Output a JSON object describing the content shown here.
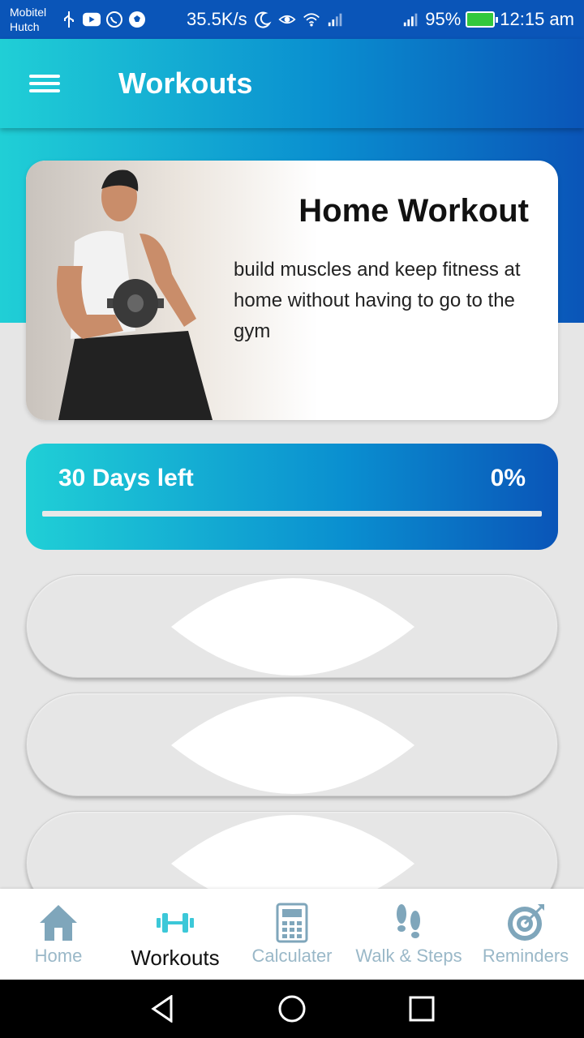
{
  "status_bar": {
    "carrier_line1": "Mobitel",
    "carrier_line2": "Hutch",
    "net_speed": "35.5K/s",
    "battery": "95%",
    "time": "12:15 am"
  },
  "app_bar": {
    "title": "Workouts",
    "menu_icon": "hamburger-menu-icon"
  },
  "promo": {
    "title": "Home Workout",
    "description": "build muscles and keep fitness at home without having to go to the gym"
  },
  "progress": {
    "days_left": "30 Days left",
    "percent": "0%",
    "fraction": 0
  },
  "workouts": [
    {
      "id": "workout-1"
    },
    {
      "id": "workout-2"
    },
    {
      "id": "workout-3"
    }
  ],
  "bottom_nav": {
    "items": [
      {
        "label": "Home",
        "icon": "home-icon",
        "active": false
      },
      {
        "label": "Workouts",
        "icon": "dumbbell-icon",
        "active": true
      },
      {
        "label": "Calculater",
        "icon": "calculator-icon",
        "active": false
      },
      {
        "label": "Walk & Steps",
        "icon": "footsteps-icon",
        "active": false
      },
      {
        "label": "Reminders",
        "icon": "target-icon",
        "active": false
      }
    ]
  },
  "colors": {
    "gradient_start": "#20cfd6",
    "gradient_end": "#0a55b8",
    "nav_inactive": "#9ab8c8",
    "nav_icon": "#7fa6bb",
    "active_icon": "#3cc8d8"
  }
}
